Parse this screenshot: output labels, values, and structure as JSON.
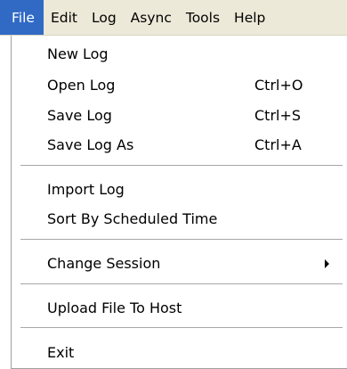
{
  "menubar": {
    "items": [
      {
        "label": "File"
      },
      {
        "label": "Edit"
      },
      {
        "label": "Log"
      },
      {
        "label": "Async"
      },
      {
        "label": "Tools"
      },
      {
        "label": "Help"
      }
    ],
    "active_item": "File"
  },
  "file_menu": {
    "items": [
      {
        "label": "New Log",
        "shortcut": ""
      },
      {
        "label": "Open Log",
        "shortcut": "Ctrl+O"
      },
      {
        "label": "Save Log",
        "shortcut": "Ctrl+S"
      },
      {
        "label": "Save Log As",
        "shortcut": "Ctrl+A"
      },
      {
        "label": "Import Log",
        "shortcut": ""
      },
      {
        "label": "Sort By Scheduled Time",
        "shortcut": ""
      },
      {
        "label": "Change Session",
        "shortcut": "",
        "has_submenu": true
      },
      {
        "label": "Upload File To Host",
        "shortcut": ""
      },
      {
        "label": "Exit",
        "shortcut": ""
      }
    ]
  },
  "colors": {
    "menubar_bg": "#ece9d8",
    "highlight": "#316ac5",
    "menu_bg": "#ffffff"
  }
}
